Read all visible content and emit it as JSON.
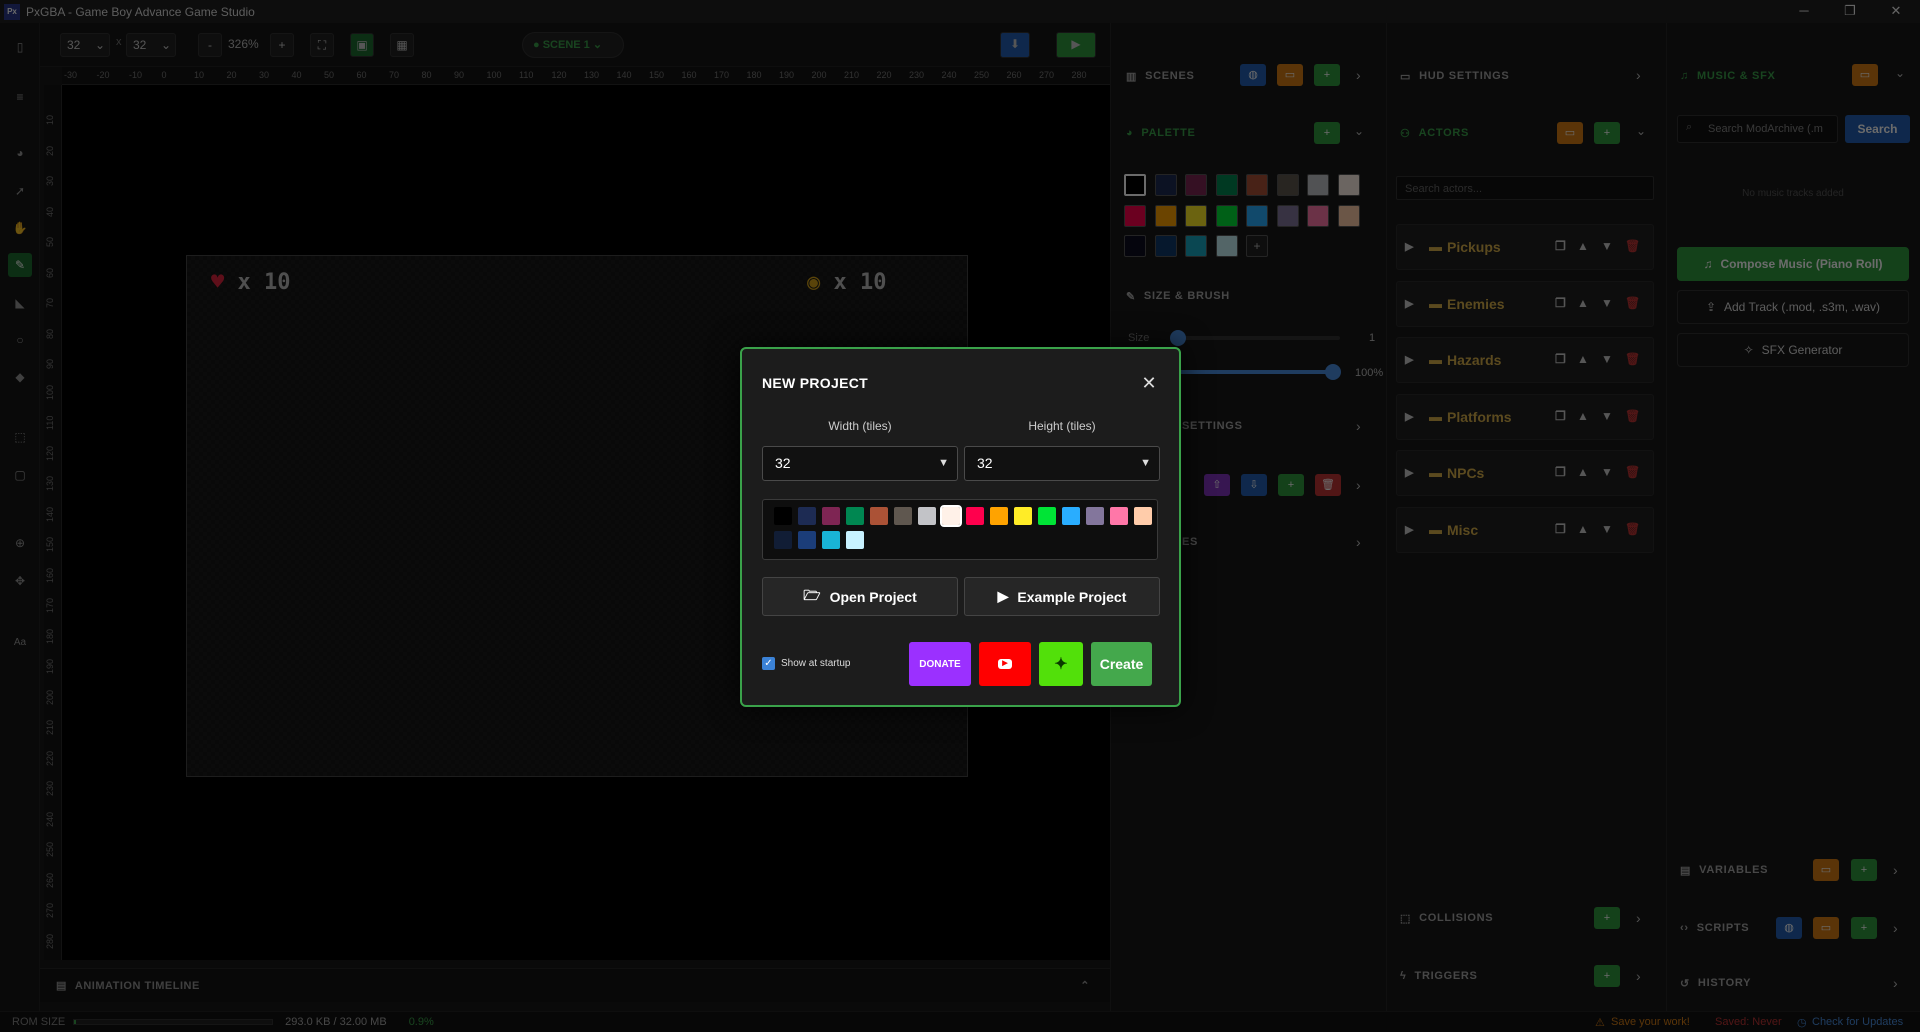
{
  "window": {
    "title": "PxGBA - Game Boy Advance Game Studio",
    "logo_text": "Px",
    "minimize": "─",
    "restore": "❐",
    "close": "✕"
  },
  "toolbar": {
    "map_width": "32",
    "map_x": "x",
    "map_height": "32",
    "zoom_out": "-",
    "zoom_level": "326%",
    "zoom_in": "+",
    "scene_selector": "SCENE 1"
  },
  "ruler": {
    "x_ticks": [
      "-30",
      "-20",
      "-10",
      "0",
      "10",
      "20",
      "30",
      "40",
      "50",
      "60",
      "70",
      "80",
      "90",
      "100",
      "110",
      "120",
      "130",
      "140",
      "150",
      "160",
      "170",
      "180",
      "190",
      "200",
      "210",
      "220",
      "230",
      "240",
      "250",
      "260",
      "270",
      "280"
    ],
    "y_ticks": [
      "10",
      "20",
      "30",
      "40",
      "50",
      "60",
      "70",
      "80",
      "90",
      "100",
      "110",
      "120",
      "130",
      "140",
      "150",
      "160",
      "170",
      "180",
      "190",
      "200",
      "210",
      "220",
      "230",
      "240",
      "250",
      "260",
      "270",
      "280"
    ]
  },
  "scene_hud": {
    "left_counter": "x 10",
    "right_counter": "x 10"
  },
  "animation_timeline": {
    "label": "ANIMATION TIMELINE"
  },
  "status": {
    "rom_label": "ROM SIZE",
    "rom_size": "293.0 KB / 32.00 MB",
    "rom_percent": "0.9%",
    "save_warning": "Save your work!",
    "saved": "Saved: Never",
    "updates": "Check for Updates"
  },
  "left_panel": {
    "scenes": "SCENES",
    "palette": "PALETTE",
    "size_brush": "SIZE & BRUSH",
    "size_label": "Size",
    "size_value": "1",
    "opacity_value": "100%",
    "settings_label": "SETTINGS",
    "partial_label": "ES",
    "palette_colors": [
      "#000000",
      "#1d2b53",
      "#7e2553",
      "#008751",
      "#ab5236",
      "#5f574f",
      "#c2c3c7",
      "#fff1e8",
      "#ff004d",
      "#ffa300",
      "#ffec27",
      "#00e436",
      "#29adff",
      "#83769c",
      "#ff77a8",
      "#ffccaa",
      "#0b0b1e",
      "#0e3a6b",
      "#19a9c4",
      "#c6f0f5"
    ],
    "palette_add": "+"
  },
  "center_panel": {
    "hud_settings": "HUD SETTINGS",
    "actors": "ACTORS",
    "search_placeholder": "Search actors...",
    "folders": [
      "Pickups",
      "Enemies",
      "Hazards",
      "Platforms",
      "NPCs",
      "Misc"
    ],
    "collisions": "COLLISIONS",
    "triggers": "TRIGGERS"
  },
  "right_panel": {
    "music_sfx": "MUSIC & SFX",
    "search_placeholder": "Search ModArchive (.m",
    "search_button": "Search",
    "no_tracks": "No music tracks added",
    "compose": "Compose Music (Piano Roll)",
    "add_track": "Add Track (.mod, .s3m, .wav)",
    "sfx": "SFX Generator",
    "variables": "VARIABLES",
    "scripts": "SCRIPTS",
    "history": "HISTORY"
  },
  "modal": {
    "title": "NEW PROJECT",
    "width_label": "Width (tiles)",
    "height_label": "Height (tiles)",
    "width_value": "32",
    "height_value": "32",
    "open_project": "Open Project",
    "example_project": "Example Project",
    "show_startup": "Show at startup",
    "show_startup_checked": true,
    "donate": "DONATE",
    "create": "Create",
    "palette_colors": [
      "#000000",
      "#1d2b53",
      "#7e2553",
      "#008751",
      "#ab5236",
      "#5f574f",
      "#c2c3c7",
      "#fff1e8",
      "#ff004d",
      "#ffa300",
      "#ffec27",
      "#00e436",
      "#29adff",
      "#83769c",
      "#ff77a8",
      "#ffccaa",
      "#111d35",
      "#1b3d79",
      "#19b4d6",
      "#c8f2ff"
    ],
    "colors": {
      "accent": "#3aa24a",
      "donate": "#9b30ff",
      "youtube": "#ff0000",
      "sparkle": "#52e00a",
      "create": "#44a84c"
    }
  }
}
